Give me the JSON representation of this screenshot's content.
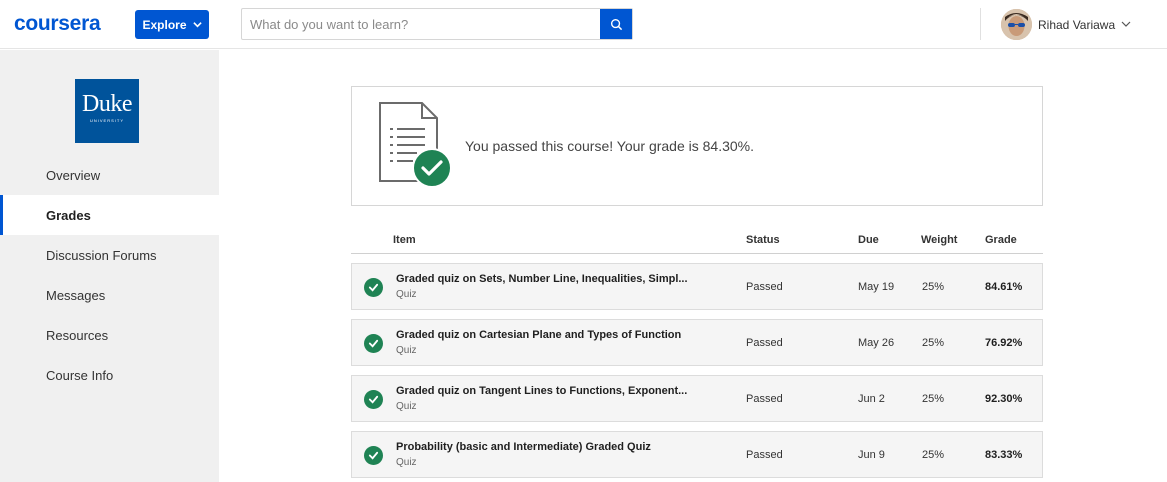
{
  "header": {
    "logo": "coursera",
    "explore_label": "Explore",
    "search_placeholder": "What do you want to learn?",
    "user_name": "Rihad Variawa"
  },
  "sidebar": {
    "logo_text": "Duke",
    "logo_subtext": "UNIVERSITY",
    "items": [
      {
        "label": "Overview"
      },
      {
        "label": "Grades"
      },
      {
        "label": "Discussion Forums"
      },
      {
        "label": "Messages"
      },
      {
        "label": "Resources"
      },
      {
        "label": "Course Info"
      }
    ],
    "active_item": "Grades"
  },
  "banner": {
    "message": "You passed this course! Your grade is 84.30%."
  },
  "table": {
    "headers": {
      "item": "Item",
      "status": "Status",
      "due": "Due",
      "weight": "Weight",
      "grade": "Grade"
    },
    "rows": [
      {
        "title": "Graded quiz on Sets, Number Line, Inequalities, Simpl...",
        "type": "Quiz",
        "status": "Passed",
        "due": "May 19",
        "weight": "25%",
        "grade": "84.61%"
      },
      {
        "title": "Graded quiz on Cartesian Plane and Types of Function",
        "type": "Quiz",
        "status": "Passed",
        "due": "May 26",
        "weight": "25%",
        "grade": "76.92%"
      },
      {
        "title": "Graded quiz on Tangent Lines to Functions, Exponent...",
        "type": "Quiz",
        "status": "Passed",
        "due": "Jun 2",
        "weight": "25%",
        "grade": "92.30%"
      },
      {
        "title": "Probability (basic and Intermediate) Graded Quiz",
        "type": "Quiz",
        "status": "Passed",
        "due": "Jun 9",
        "weight": "25%",
        "grade": "83.33%"
      }
    ]
  },
  "colors": {
    "brand": "#0056d2",
    "duke_blue": "#00539b",
    "passed_green": "#1f8354"
  }
}
